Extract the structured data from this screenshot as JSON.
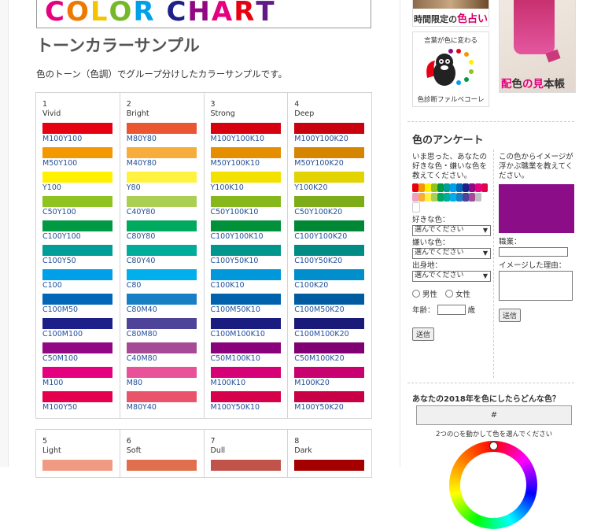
{
  "banner": {
    "letters": [
      {
        "ch": "C",
        "color": "#e4007f"
      },
      {
        "ch": "O",
        "color": "#ee7800"
      },
      {
        "ch": "L",
        "color": "#f5c400"
      },
      {
        "ch": "O",
        "color": "#76b82a"
      },
      {
        "ch": "R",
        "color": "#00a0e9"
      },
      {
        "ch": " ",
        "color": "#fff"
      },
      {
        "ch": "C",
        "color": "#1d2088"
      },
      {
        "ch": "H",
        "color": "#920783"
      },
      {
        "ch": "A",
        "color": "#e4007f"
      },
      {
        "ch": "R",
        "color": "#e60012"
      },
      {
        "ch": "T",
        "color": "#601986"
      }
    ]
  },
  "page": {
    "title": "トーンカラーサンプル",
    "description": "色のトーン（色調）でグループ分けしたカラーサンプルです。"
  },
  "tones": [
    {
      "num": "1",
      "name": "Vivid",
      "swatches": [
        {
          "label": "M100Y100",
          "color": "#e60012"
        },
        {
          "label": "M50Y100",
          "color": "#f39800"
        },
        {
          "label": "Y100",
          "color": "#fff100"
        },
        {
          "label": "C50Y100",
          "color": "#8fc31f"
        },
        {
          "label": "C100Y100",
          "color": "#009944"
        },
        {
          "label": "C100Y50",
          "color": "#009e96"
        },
        {
          "label": "C100",
          "color": "#00a0e9"
        },
        {
          "label": "C100M50",
          "color": "#0068b7"
        },
        {
          "label": "C100M100",
          "color": "#1d2088"
        },
        {
          "label": "C50M100",
          "color": "#920783"
        },
        {
          "label": "M100",
          "color": "#e4007f"
        },
        {
          "label": "M100Y50",
          "color": "#e5004f"
        }
      ]
    },
    {
      "num": "2",
      "name": "Bright",
      "swatches": [
        {
          "label": "M80Y80",
          "color": "#ea5532"
        },
        {
          "label": "M40Y80",
          "color": "#f6ad3c"
        },
        {
          "label": "Y80",
          "color": "#fff33f"
        },
        {
          "label": "C40Y80",
          "color": "#aacf52"
        },
        {
          "label": "C80Y80",
          "color": "#00a960"
        },
        {
          "label": "C80Y40",
          "color": "#00ac9a"
        },
        {
          "label": "C80",
          "color": "#00afec"
        },
        {
          "label": "C80M40",
          "color": "#187fc4"
        },
        {
          "label": "C80M80",
          "color": "#4d4398"
        },
        {
          "label": "C40M80",
          "color": "#a64a97"
        },
        {
          "label": "M80",
          "color": "#e85298"
        },
        {
          "label": "M80Y40",
          "color": "#e9546b"
        }
      ]
    },
    {
      "num": "3",
      "name": "Strong",
      "swatches": [
        {
          "label": "M100Y100K10",
          "color": "#d7000f"
        },
        {
          "label": "M50Y100K10",
          "color": "#e48e00"
        },
        {
          "label": "Y100K10",
          "color": "#f3e100"
        },
        {
          "label": "C50Y100K10",
          "color": "#86b81b"
        },
        {
          "label": "C100Y100K10",
          "color": "#00913a"
        },
        {
          "label": "C100Y50K10",
          "color": "#00958d"
        },
        {
          "label": "C100K10",
          "color": "#0097db"
        },
        {
          "label": "C100M50K10",
          "color": "#0062ac"
        },
        {
          "label": "C100M100K10",
          "color": "#1b1c80"
        },
        {
          "label": "C50M100K10",
          "color": "#8a017c"
        },
        {
          "label": "M100K10",
          "color": "#d60077"
        },
        {
          "label": "M100Y50K10",
          "color": "#d7004a"
        }
      ]
    },
    {
      "num": "4",
      "name": "Deep",
      "swatches": [
        {
          "label": "M100Y100K20",
          "color": "#c9000e"
        },
        {
          "label": "M50Y100K20",
          "color": "#d58500"
        },
        {
          "label": "Y100K20",
          "color": "#e3d300"
        },
        {
          "label": "C50Y100K20",
          "color": "#7eac19"
        },
        {
          "label": "C100Y100K20",
          "color": "#008837"
        },
        {
          "label": "C100Y50K20",
          "color": "#008c84"
        },
        {
          "label": "C100K20",
          "color": "#008ecd"
        },
        {
          "label": "C100M50K20",
          "color": "#005ca1"
        },
        {
          "label": "C100M100K20",
          "color": "#1a1a78"
        },
        {
          "label": "C50M100K20",
          "color": "#800073"
        },
        {
          "label": "M100K20",
          "color": "#c9006f"
        },
        {
          "label": "M100Y50K20",
          "color": "#c90045"
        }
      ]
    }
  ],
  "tones2": [
    {
      "num": "5",
      "name": "Light",
      "color": "#f19a83"
    },
    {
      "num": "6",
      "name": "Soft",
      "color": "#e06f4d"
    },
    {
      "num": "7",
      "name": "Dull",
      "color": "#c0544a"
    },
    {
      "num": "8",
      "name": "Dark",
      "color": "#a40000"
    }
  ],
  "ads": {
    "fortune": {
      "prefix": "時間限定の",
      "accent": "色占い"
    },
    "squirrel": {
      "top": "言葉が色に変わる",
      "bottom": "色診断ファルベコーレ"
    },
    "book": {
      "c1": "配",
      "c2": "色",
      "c3": "の見",
      "c4": "本帳"
    }
  },
  "survey": {
    "title": "色のアンケート",
    "intro": "いま思った、あなたの好きな色・嫌いな色を教えてください。",
    "likes_label": "好きな色：",
    "dislikes_label": "嫌いな色：",
    "birthplace_label": "出身地：",
    "select_placeholder": "選んでください",
    "male": "男性",
    "female": "女性",
    "age_label": "年齢：",
    "age_unit": "歳",
    "submit": "送信",
    "right_intro": "この色からイメージが浮かぶ職業を教えてください。",
    "job_label": "職業：",
    "reason_label": "イメージした理由：",
    "right_submit": "送信",
    "swatch_color": "#8b0d87",
    "palette": [
      "#e60012",
      "#f39800",
      "#fff100",
      "#8fc31f",
      "#009944",
      "#009e96",
      "#00a0e9",
      "#0068b7",
      "#1d2088",
      "#920783",
      "#e4007f",
      "#e5004f",
      "#f19ec2",
      "#f6ad3c",
      "#fff33f",
      "#aacf52",
      "#00a960",
      "#00ac9a",
      "#00afec",
      "#187fc4",
      "#4d4398",
      "#a64a97",
      "#c0c0c0",
      "#ffffff"
    ]
  },
  "color2018": {
    "title": "あなたの2018年を色にしたらどんな色？",
    "value": "#",
    "hint": "2つの○を動かして色を選んでください"
  }
}
